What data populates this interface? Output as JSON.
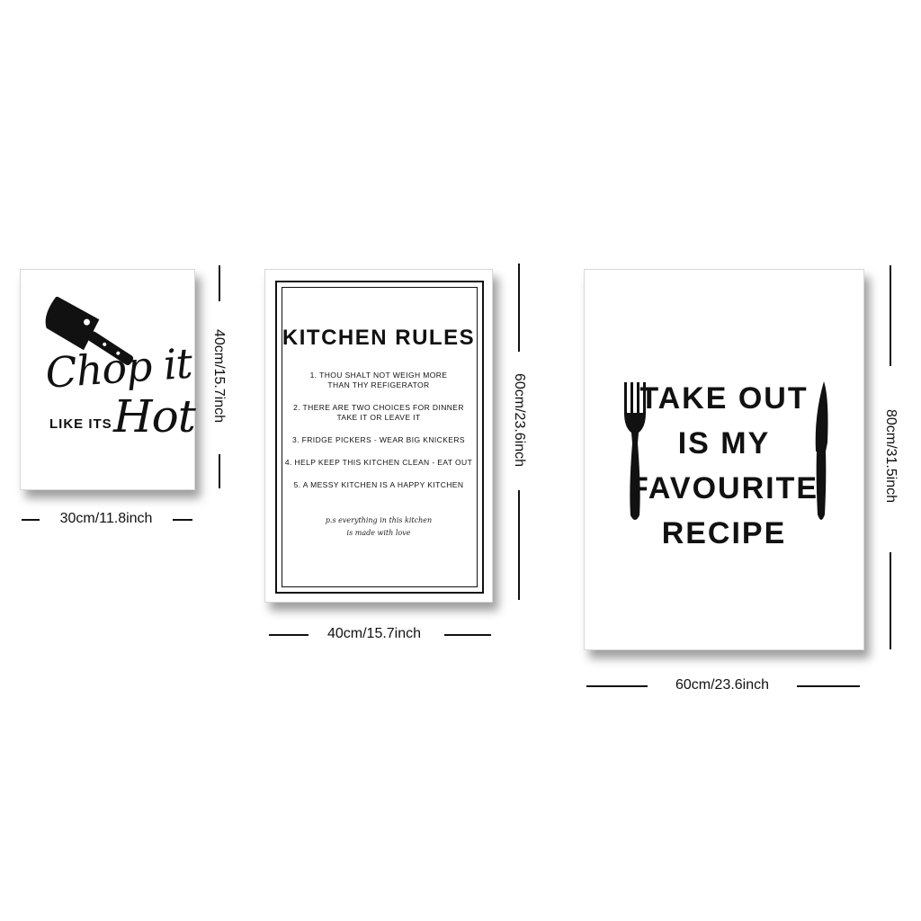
{
  "posters": [
    {
      "script_line": "Chop it",
      "caps_line": "LIKE ITS",
      "script_word": "Hot",
      "width_label": "30cm/11.8inch",
      "height_label": "40cm/15.7inch",
      "icon": "cleaver-icon"
    },
    {
      "title": "KITCHEN RULES",
      "rules": [
        "1. THOU SHALT NOT WEIGH MORE\nTHAN THY REFIGERATOR",
        "2. THERE ARE TWO CHOICES FOR DINNER\nTAKE IT OR LEAVE IT",
        "3. FRIDGE PICKERS - WEAR BIG KNICKERS",
        "4. HELP KEEP THIS KITCHEN CLEAN - EAT OUT",
        "5. A MESSY KITCHEN IS A HAPPY KITCHEN"
      ],
      "footer": "p.s everything in this kitchen\nis made with love",
      "width_label": "40cm/15.7inch",
      "height_label": "60cm/23.6inch"
    },
    {
      "text": "TAKE OUT\nIS MY\nFAVOURITE\nRECIPE",
      "width_label": "60cm/23.6inch",
      "height_label": "80cm/31.5inch",
      "icons": [
        "fork-icon",
        "knife-icon"
      ]
    }
  ],
  "colors": {
    "background": "#ffffff",
    "ink": "#111111"
  }
}
